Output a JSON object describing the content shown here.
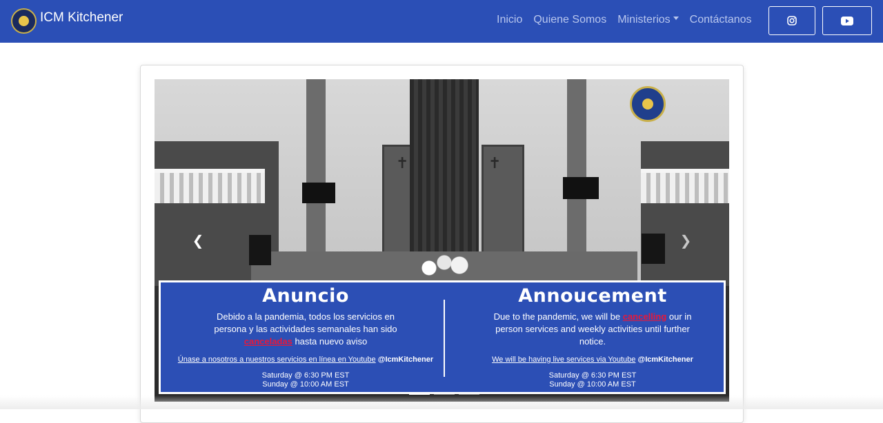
{
  "navbar": {
    "brand": "ICM Kitchener",
    "links": [
      "Inicio",
      "Quiene Somos",
      "Ministerios",
      "Contáctanos"
    ],
    "social": [
      "instagram-icon",
      "youtube-icon"
    ],
    "colors": {
      "bar": "#2b4fb6",
      "link": "#b9c7ee"
    }
  },
  "carousel": {
    "slide_count": 3,
    "active_index": 0,
    "banner": {
      "es": {
        "title": "Anuncio",
        "body_before": "Debido a la pandemia, todos los servicios en persona y las actividades semanales han sido",
        "highlight": "canceladas",
        "body_after": " hasta nuevo aviso",
        "live_text": "Únase a nosotros a nuestros servicios en línea en Youtube",
        "live_handle": " @IcmKitchener",
        "sched_1": "Saturday @ 6:30 PM EST",
        "sched_2": "Sunday @ 10:00 AM EST"
      },
      "en": {
        "title": "Annoucement",
        "body_before": "Due to the pandemic, we will be ",
        "highlight": "cancelling",
        "body_after": " our in person services and weekly activities until further notice.",
        "live_text": "We will be having live services via Youtube",
        "live_handle": " @IcmKitchener",
        "sched_1": "Saturday @ 6:30 PM EST",
        "sched_2": "Sunday @ 10:00 AM EST"
      },
      "colors": {
        "background": "#2c4fb5",
        "highlight": "#e8183a"
      }
    }
  }
}
